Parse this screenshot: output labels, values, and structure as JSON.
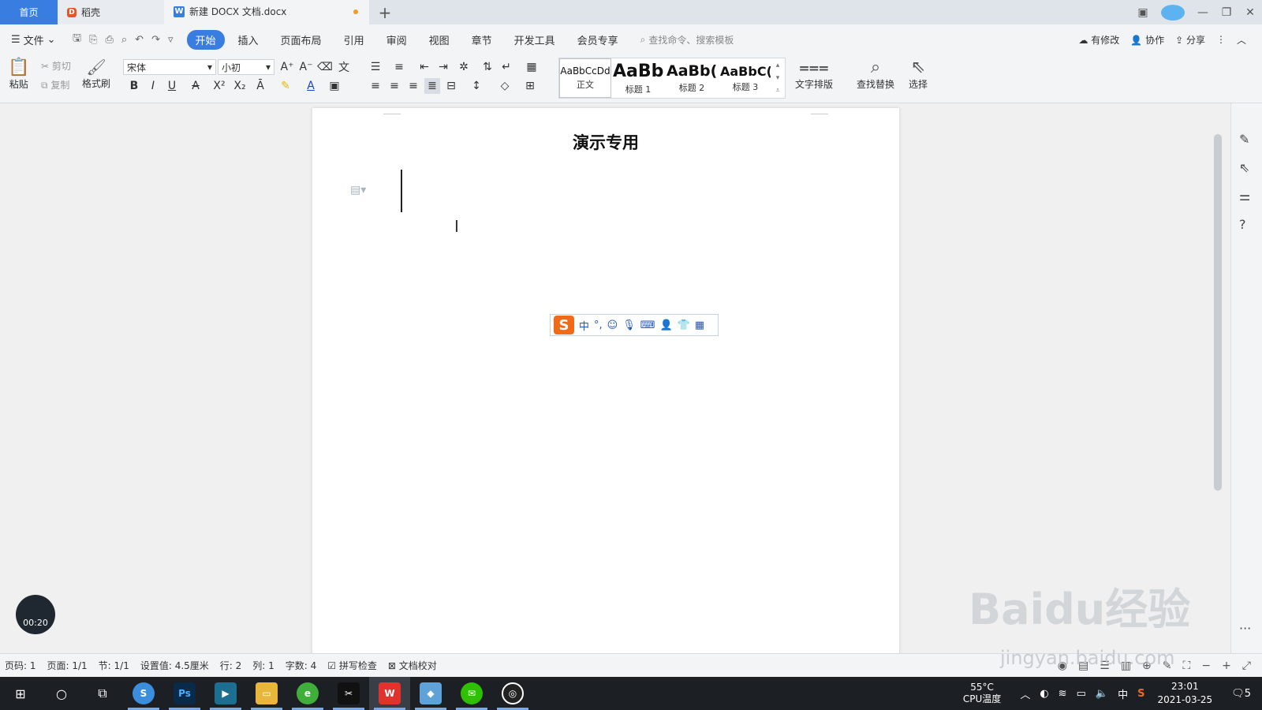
{
  "tabs": {
    "home": "首页",
    "daoke": "稻壳",
    "document": "新建 DOCX 文档.docx"
  },
  "menubar": {
    "file": "文件",
    "items": [
      "开始",
      "插入",
      "页面布局",
      "引用",
      "审阅",
      "视图",
      "章节",
      "开发工具",
      "会员专享"
    ],
    "search_placeholder": "查找命令、搜索模板",
    "modified": "有修改",
    "collab": "协作",
    "share": "分享"
  },
  "ribbon": {
    "paste": "粘贴",
    "cut": "剪切",
    "copy": "复制",
    "format_painter": "格式刷",
    "font_name": "宋体",
    "font_size": "小初",
    "styles": [
      {
        "sample": "AaBbCcDd",
        "name": "正文"
      },
      {
        "sample": "AaBb",
        "name": "标题 1"
      },
      {
        "sample": "AaBb(",
        "name": "标题 2"
      },
      {
        "sample": "AaBbC(",
        "name": "标题 3"
      }
    ],
    "text_layout": "文字排版",
    "find_replace": "查找替换",
    "select": "选择"
  },
  "document": {
    "title": "演示专用"
  },
  "ime": {
    "mode": "中",
    "punct": "°,"
  },
  "timer": "00:20",
  "statusbar": {
    "page_num": "页码: 1",
    "pages": "页面: 1/1",
    "section": "节: 1/1",
    "position": "设置值: 4.5厘米",
    "row": "行: 2",
    "col": "列: 1",
    "word_count": "字数: 4",
    "spell_check": "拼写检查",
    "doc_proof": "文档校对"
  },
  "tray": {
    "cpu_temp": "55°C",
    "cpu_label": "CPU温度",
    "ime": "中",
    "time": "23:01",
    "date": "2021-03-25",
    "notif_count": "5"
  },
  "watermark": {
    "brand": "Baidu经验",
    "url": "jingyan.baidu.com"
  },
  "colors": {
    "accent": "#3a7de0",
    "ime_orange": "#f06a1a",
    "taskbar": "#1c1f24"
  }
}
